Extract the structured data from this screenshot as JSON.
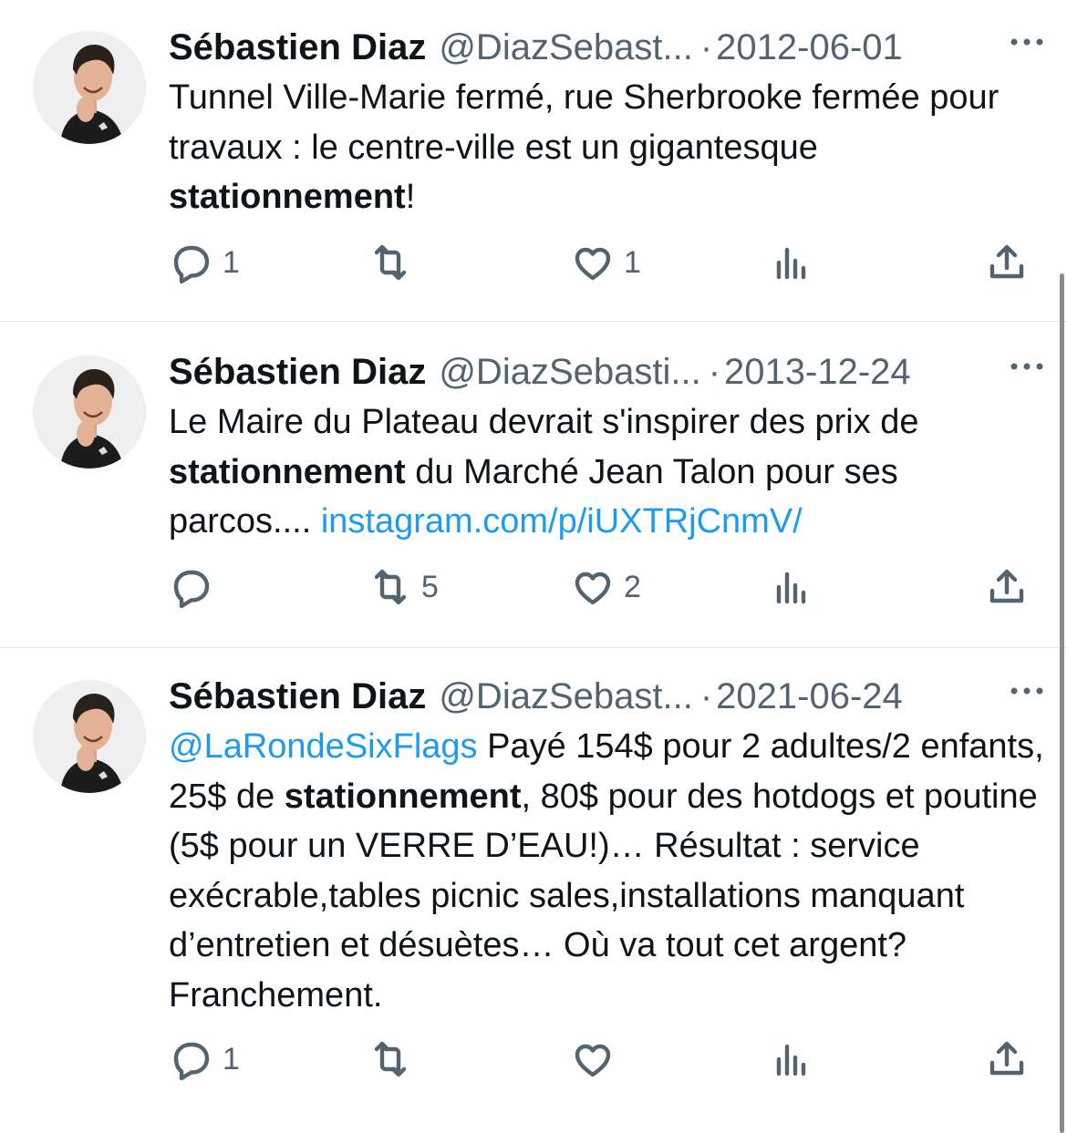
{
  "tweets": [
    {
      "name": "Sébastien Diaz",
      "handle": "@DiazSebast...",
      "sep": "·",
      "date": "2012-06-01",
      "text": {
        "t1": "Tunnel Ville-Marie fermé, rue Sherbrooke fermée pour travaux : le centre-ville est un gigantesque ",
        "b1": "stationnement",
        "t2": "!"
      },
      "replies": "1",
      "retweets": "",
      "likes": "1"
    },
    {
      "name": "Sébastien Diaz",
      "handle": "@DiazSebasti...",
      "sep": "·",
      "date": "2013-12-24",
      "text": {
        "t1": "Le Maire du Plateau devrait s'inspirer des prix de ",
        "b1": "stationnement",
        "t2": " du Marché Jean Talon pour ses parcos.... ",
        "link": "instagram.com/p/iUXTRjCnmV/"
      },
      "replies": "",
      "retweets": "5",
      "likes": "2"
    },
    {
      "name": "Sébastien Diaz",
      "handle": "@DiazSebast...",
      "sep": "·",
      "date": "2021-06-24",
      "text": {
        "mention": "@LaRondeSixFlags",
        "t1": " Payé 154$ pour 2 adultes/2 enfants, 25$ de ",
        "b1": "stationnement",
        "t2": ", 80$ pour des hotdogs et poutine (5$ pour un VERRE D’EAU!)… Résultat : service exécrable,tables picnic sales,installations manquant d’entretien et désuètes… Où va tout cet argent? Franchement."
      },
      "replies": "1",
      "retweets": "",
      "likes": ""
    }
  ],
  "icons": [
    "reply-icon",
    "retweet-icon",
    "like-icon",
    "views-icon",
    "share-icon",
    "more-icon"
  ],
  "colors": {
    "text": "#0f1419",
    "secondary": "#536471",
    "link": "#1d9bf0",
    "divider": "#e6e9ec"
  }
}
